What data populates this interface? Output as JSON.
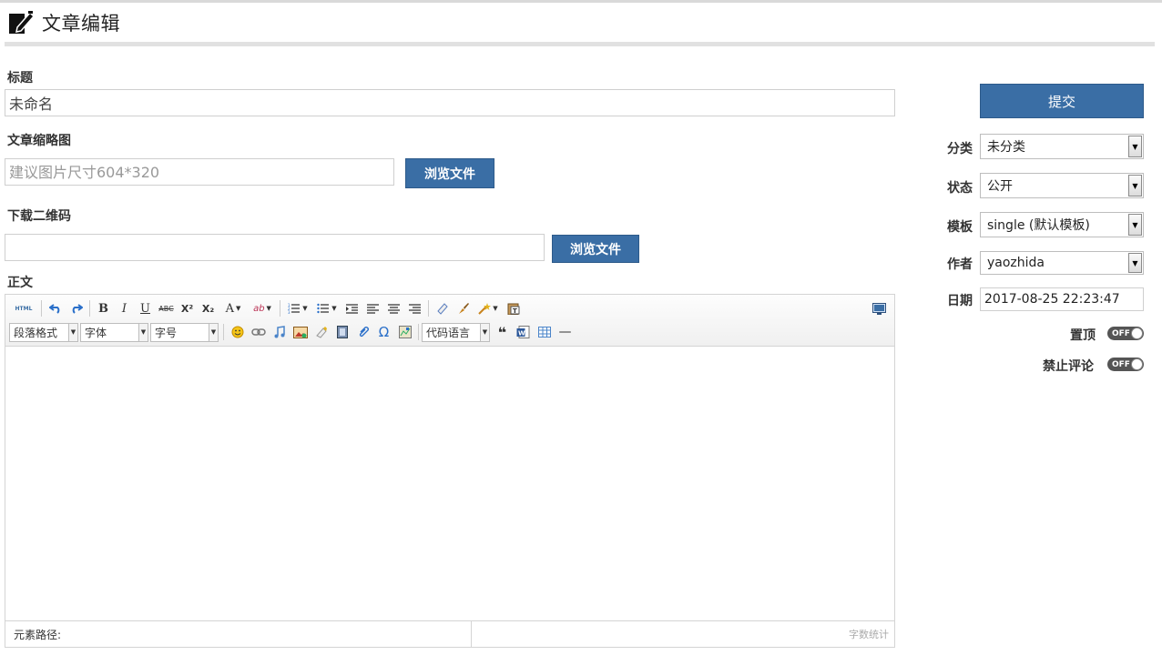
{
  "page": {
    "title": "文章编辑"
  },
  "form": {
    "title_label": "标题",
    "title_value": "未命名",
    "thumb_label": "文章缩略图",
    "thumb_placeholder": "建议图片尺寸604*320",
    "browse_label": "浏览文件",
    "qrcode_label": "下载二维码",
    "qrcode_value": "",
    "body_label": "正文"
  },
  "editor": {
    "combos": {
      "paragraph": "段落格式",
      "font": "字体",
      "size": "字号",
      "code_lang": "代码语言"
    },
    "toolbar_icons": [
      "html-source-icon",
      "undo-icon",
      "redo-icon",
      "bold-icon",
      "italic-icon",
      "underline-icon",
      "strikethrough-icon",
      "superscript-icon",
      "subscript-icon",
      "font-color-icon",
      "highlight-icon",
      "ordered-list-icon",
      "unordered-list-icon",
      "indent-icon",
      "align-left-icon",
      "align-center-icon",
      "align-right-icon",
      "eraser-icon",
      "format-brush-icon",
      "magic-wand-icon",
      "paste-text-icon",
      "fullscreen-icon",
      "emoticon-icon",
      "link-icon",
      "music-icon",
      "image-icon",
      "clear-doc-icon",
      "video-icon",
      "attachment-icon",
      "omega-icon",
      "map-icon",
      "blockquote-icon",
      "word-icon",
      "table-icon",
      "horizontal-rule-icon"
    ],
    "labels": {
      "bold": "B",
      "italic": "I",
      "underline": "U",
      "strike": "ABC",
      "sup": "X²",
      "sub": "X₂",
      "font_color": "A",
      "highlight": "ab",
      "omega": "Ω",
      "quote": "❝",
      "hr": "—",
      "html": "HTML"
    },
    "footer_path": "元素路径:",
    "footer_count": "字数统计"
  },
  "sidebar": {
    "submit_label": "提交",
    "category": {
      "label": "分类",
      "value": "未分类"
    },
    "status": {
      "label": "状态",
      "value": "公开"
    },
    "template": {
      "label": "模板",
      "value": "single (默认模板)"
    },
    "author": {
      "label": "作者",
      "value": "yaozhida"
    },
    "date": {
      "label": "日期",
      "value": "2017-08-25 22:23:47"
    },
    "sticky": {
      "label": "置顶",
      "state": "OFF"
    },
    "no_comment": {
      "label": "禁止评论",
      "state": "OFF"
    }
  },
  "colors": {
    "primary": "#3a6ea5",
    "toggle_off": "#555555",
    "rule": "#e1e1e1"
  }
}
